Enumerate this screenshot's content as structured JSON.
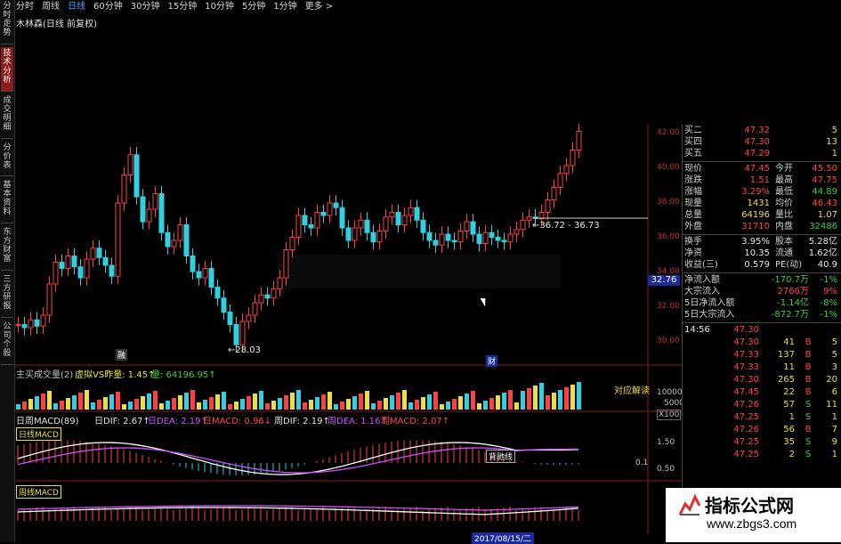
{
  "left_tabs": [
    {
      "label": "分时走势",
      "active": false
    },
    {
      "label": "技术分析",
      "active": true
    },
    {
      "label": "成交明细",
      "active": false
    },
    {
      "label": "分价表",
      "active": false
    },
    {
      "label": "基本资料",
      "active": false
    },
    {
      "label": "东方财富",
      "active": false
    },
    {
      "label": "三方研报",
      "active": false
    },
    {
      "label": "公司个股",
      "active": false
    }
  ],
  "periods": [
    {
      "label": "分时",
      "selected": false
    },
    {
      "label": "周线",
      "selected": false
    },
    {
      "label": "日线",
      "selected": true
    },
    {
      "label": "60分钟",
      "selected": false
    },
    {
      "label": "30分钟",
      "selected": false
    },
    {
      "label": "15分钟",
      "selected": false
    },
    {
      "label": "10分钟",
      "selected": false
    },
    {
      "label": "5分钟",
      "selected": false
    },
    {
      "label": "1分钟",
      "selected": false
    },
    {
      "label": "更多 >",
      "selected": false
    }
  ],
  "stock_name": "木林森(日线 前复权)",
  "price_axis": [
    "42.00",
    "40.00",
    "38.00",
    "36.00",
    "34.00",
    "32.00",
    "30.00"
  ],
  "price_tag": "32.76",
  "annotations": {
    "low": "←28.03",
    "range": "←36.72 - 36.73",
    "event1": "融",
    "event2": "财",
    "mid": "融"
  },
  "volume_panel": {
    "title": "主买成交量(2)",
    "ratio_label": "虚拟VS昨量: 1.45↑",
    "vol_label": "量: 64196.95↑",
    "right_label": "对应解读",
    "axis": [
      "10000",
      "5000"
    ],
    "unit": "X100"
  },
  "macd_header": {
    "title": "日周MACD(89)",
    "dif": "日DIF: 2.67↑",
    "dea": "日DEA: 2.19↑",
    "macd": "日MACD: 0.96↓",
    "wdif": "周DIF: 2.19↑",
    "wdea": "周DEA: 1.16↑",
    "wmacd": "周MACD: 2.07↑"
  },
  "macd_day_label": "日线MACD",
  "macd_week_label": "周线MACD",
  "macd_note": "背驰线",
  "macd_axis": [
    "1.50",
    "0.50",
    "0.1"
  ],
  "date_label": "2017/08/15/二",
  "quote": {
    "asks": [
      {
        "label": "买二",
        "price": "47.32",
        "vol": "5"
      },
      {
        "label": "买四",
        "price": "47.30",
        "vol": "13"
      },
      {
        "label": "买五",
        "price": "47.29",
        "vol": "1"
      }
    ],
    "rows": [
      {
        "l1": "现价",
        "v1": "47.45",
        "l2": "今开",
        "v2": "45.50"
      },
      {
        "l1": "涨跌",
        "v1": "1.51",
        "l2": "最高",
        "v2": "47.75"
      },
      {
        "l1": "涨幅",
        "v1": "3.29%",
        "l2": "最低",
        "v2": "44.89"
      },
      {
        "l1": "现量",
        "v1": "1431",
        "l2": "均价",
        "v2": "46.43"
      },
      {
        "l1": "总量",
        "v1": "64196",
        "l2": "量比",
        "v2": "1.07"
      },
      {
        "l1": "外盘",
        "v1": "31710",
        "l2": "内盘",
        "v2": "32486"
      }
    ],
    "fin": [
      {
        "l1": "换手",
        "v1": "3.95%",
        "l2": "股本",
        "v2": "5.28亿"
      },
      {
        "l1": "净资",
        "v1": "10.35",
        "l2": "流通",
        "v2": "1.62亿"
      },
      {
        "l1": "收益(三)",
        "v1": "0.579",
        "l2": "PE(动)",
        "v2": "40.9"
      }
    ],
    "flows": [
      {
        "label": "净流入额",
        "value": "-170.7万",
        "pct": "-1%"
      },
      {
        "label": "大宗流入",
        "value": "2766万",
        "pct": "9%"
      },
      {
        "label": "5日净流入额",
        "value": "-1.14亿",
        "pct": "-8%"
      },
      {
        "label": "5日大宗流入",
        "value": "-872.7万",
        "pct": "-1%"
      }
    ],
    "time": "14:56",
    "ticks": [
      {
        "p": "47.30",
        "v": "41",
        "d": "B",
        "n": "5"
      },
      {
        "p": "47.33",
        "v": "137",
        "d": "B",
        "n": "5"
      },
      {
        "p": "47.33",
        "v": "11",
        "d": "B",
        "n": "3"
      },
      {
        "p": "47.30",
        "v": "265",
        "d": "B",
        "n": "20"
      },
      {
        "p": "47.45",
        "v": "22",
        "d": "B",
        "n": "6"
      },
      {
        "p": "47.26",
        "v": "57",
        "d": "S",
        "n": "11"
      },
      {
        "p": "47.25",
        "v": "1",
        "d": "S",
        "n": "1"
      },
      {
        "p": "47.26",
        "v": "56",
        "d": "B",
        "n": "7"
      },
      {
        "p": "47.25",
        "v": "35",
        "d": "S",
        "n": "9"
      },
      {
        "p": "47.25",
        "v": "2",
        "d": "S",
        "n": "1"
      }
    ],
    "tick_first_price": "47.30"
  },
  "watermark": {
    "title": "指标公式网",
    "url": "www.zbgs3.com"
  }
}
